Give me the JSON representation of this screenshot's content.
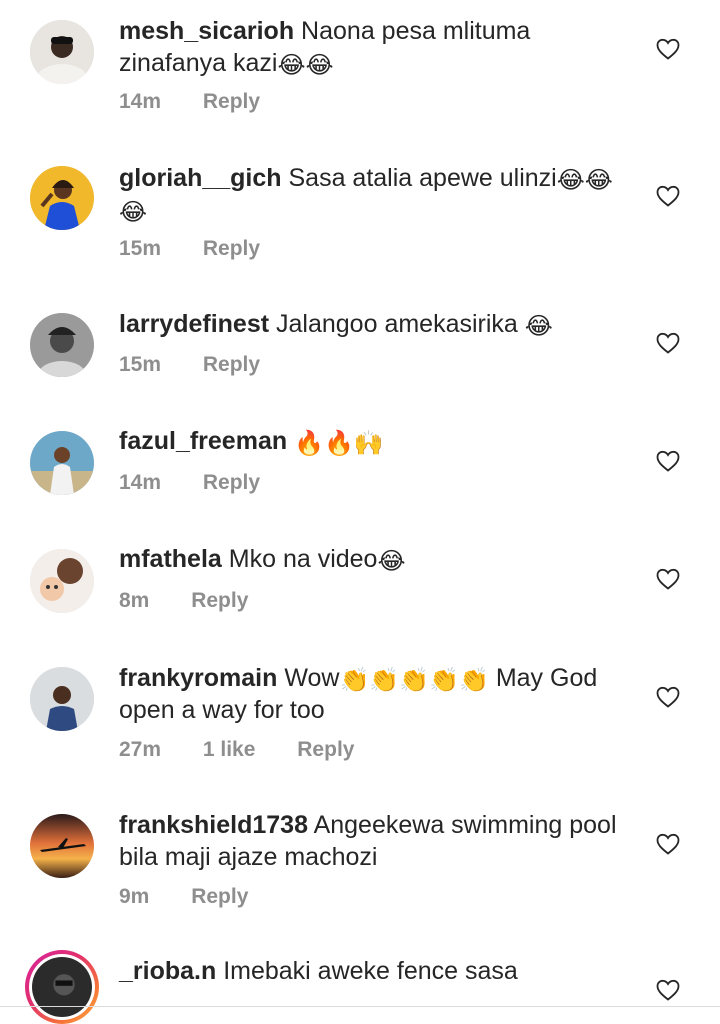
{
  "comments": [
    {
      "username": "mesh_sicarioh",
      "text_line1": "Naona pesa mlituma",
      "text_line2": "zinafanya kazi",
      "emoji": "😂😂",
      "time": "14m",
      "likes": "",
      "reply_label": "Reply"
    },
    {
      "username": "gloriah__gich",
      "text_line1": "Sasa atalia apewe ulinzi",
      "emoji": "😂😂",
      "emoji_line2": "😂",
      "time": "15m",
      "likes": "",
      "reply_label": "Reply"
    },
    {
      "username": "larrydefinest",
      "text_line1": "Jalangoo amekasirika",
      "emoji": "😂",
      "time": "15m",
      "likes": "",
      "reply_label": "Reply"
    },
    {
      "username": "fazul_freeman",
      "text_line1": "",
      "emoji": "🔥🔥🙌",
      "time": "14m",
      "likes": "",
      "reply_label": "Reply"
    },
    {
      "username": "mfathela",
      "text_line1": "Mko na video",
      "emoji": "😂",
      "time": "8m",
      "likes": "",
      "reply_label": "Reply"
    },
    {
      "username": "frankyromain",
      "text_line1": "Wow",
      "emoji": "👏👏👏👏👏",
      "text_after": "May God",
      "text_line2": "open a way for too",
      "time": "27m",
      "likes": "1 like",
      "reply_label": "Reply"
    },
    {
      "username": "frankshield1738",
      "text_line1": "Angeekewa swimming pool",
      "text_line2": "bila maji ajaze machozi",
      "time": "9m",
      "likes": "",
      "reply_label": "Reply"
    },
    {
      "username": "_rioba.n",
      "text_line1": "Imebaki aweke fence sasa",
      "time": "",
      "likes": "",
      "reply_label": ""
    }
  ],
  "icons": {
    "like": "heart-outline-icon"
  },
  "colors": {
    "text": "#262626",
    "secondary": "#8e8e8e",
    "heart": "#262626"
  }
}
